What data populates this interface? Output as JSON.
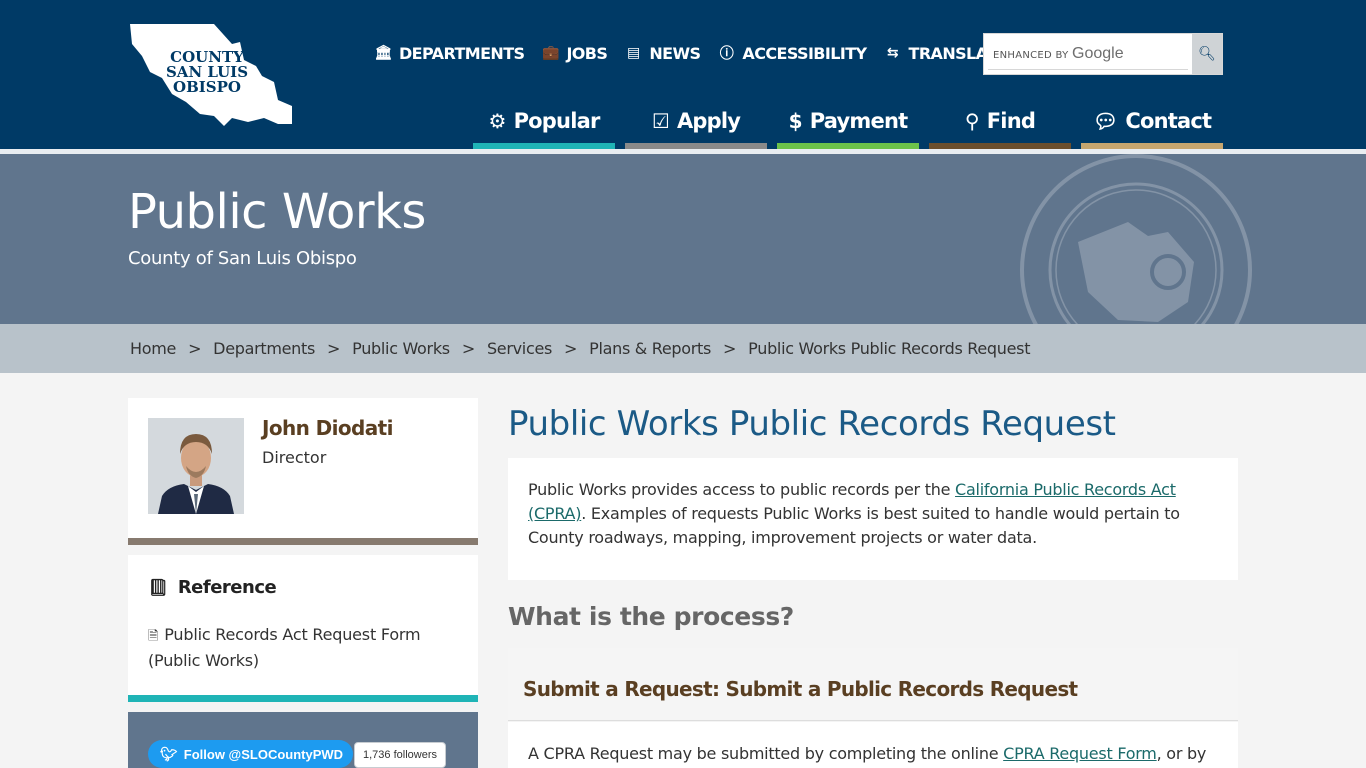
{
  "logo": {
    "line1": "COUNTY",
    "line2": "SAN LUIS",
    "line3": "OBISPO",
    "of": "of"
  },
  "topnav": [
    {
      "label": "DEPARTMENTS",
      "icon": "building-icon"
    },
    {
      "label": "JOBS",
      "icon": "briefcase-icon"
    },
    {
      "label": "NEWS",
      "icon": "newspaper-icon"
    },
    {
      "label": "ACCESSIBILITY",
      "icon": "info-icon"
    },
    {
      "label": "TRANSLATE",
      "icon": "language-icon"
    }
  ],
  "search": {
    "enhanced_by": "ENHANCED BY",
    "google": "Google"
  },
  "mainnav": [
    {
      "label": "Popular",
      "icon": "gear-icon",
      "color": "#1fb4b6"
    },
    {
      "label": "Apply",
      "icon": "checkbox-icon",
      "color": "#8a8a8a"
    },
    {
      "label": "Payment",
      "icon": "dollar-icon",
      "color": "#6cc24a"
    },
    {
      "label": "Find",
      "icon": "search-icon",
      "color": "#6b4f2e"
    },
    {
      "label": "Contact",
      "icon": "chat-icon",
      "color": "#c6a66f"
    }
  ],
  "hero": {
    "title": "Public Works",
    "subtitle": "County of San Luis Obispo"
  },
  "breadcrumb": {
    "items": [
      "Home",
      "Departments",
      "Public Works",
      "Services",
      "Plans & Reports"
    ],
    "current": "Public Works Public Records Request",
    "separator": ">"
  },
  "director": {
    "name": "John Diodati",
    "title": "Director"
  },
  "reference": {
    "heading": "Reference",
    "link": "Public Records Act Request Form (Public Works)"
  },
  "twitter": {
    "button": "Follow @SLOCountyPWD",
    "followers": "1,736 followers"
  },
  "main": {
    "title": "Public Works Public Records Request",
    "intro_before": "Public Works provides access to public records per the ",
    "intro_link": "California Public Records Act (CPRA)",
    "intro_after": ". Examples of requests Public Works is best suited to handle would pertain to County roadways, mapping, improvement projects or water data.",
    "process_heading": "What is the process?",
    "step_heading": "Submit a Request: Submit a Public Records Request",
    "step_before": "A CPRA Request may be submitted by completing the online ",
    "step_link": "CPRA Request Form",
    "step_after": ", or by"
  },
  "colors": {
    "header": "#003a66",
    "hero": "#60758d",
    "breadcrumb": "#b8c2ca",
    "title": "#1b5a86"
  }
}
